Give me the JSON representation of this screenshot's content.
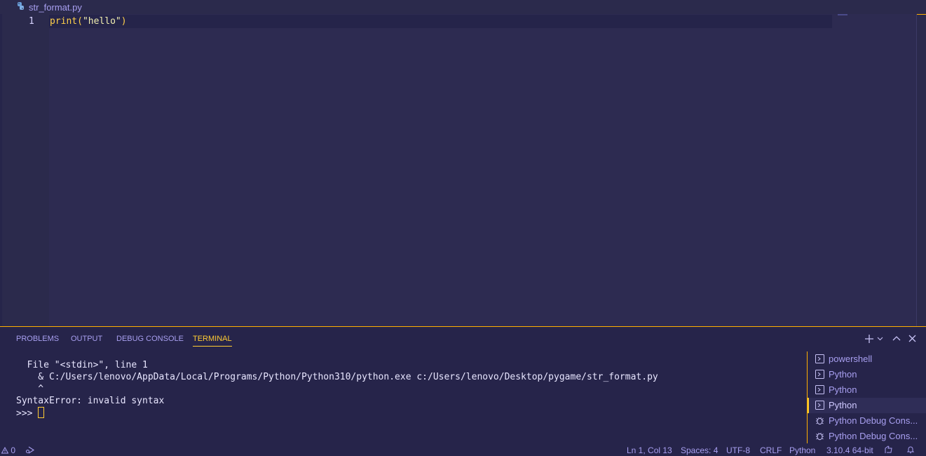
{
  "breadcrumb": {
    "file_name": "str_format.py"
  },
  "editor": {
    "line_number": "1",
    "code": {
      "fn": "print",
      "open": "(",
      "str": "\"hello\"",
      "close": ")"
    }
  },
  "panel": {
    "tabs": [
      "PROBLEMS",
      "OUTPUT",
      "DEBUG CONSOLE",
      "TERMINAL"
    ],
    "active_tab": "TERMINAL",
    "terminal_lines": [
      "  File \"<stdin>\", line 1",
      "    & C:/Users/lenovo/AppData/Local/Programs/Python/Python310/python.exe c:/Users/lenovo/Desktop/pygame/str_format.py",
      "    ^",
      "SyntaxError: invalid syntax"
    ],
    "prompt": ">>> ",
    "terminals": [
      "powershell",
      "Python",
      "Python",
      "Python",
      "Python Debug Cons...",
      "Python Debug Cons..."
    ],
    "selected_terminal_index": 3
  },
  "statusbar": {
    "problems_count": "0",
    "position": "Ln 1, Col 13",
    "spaces": "Spaces: 4",
    "encoding": "UTF-8",
    "eol": "CRLF",
    "language": "Python",
    "interpreter": "3.10.4 64-bit"
  },
  "colors": {
    "accent": "#ffcc33",
    "background": "#2b2a4c",
    "text": "#a89ff0"
  }
}
